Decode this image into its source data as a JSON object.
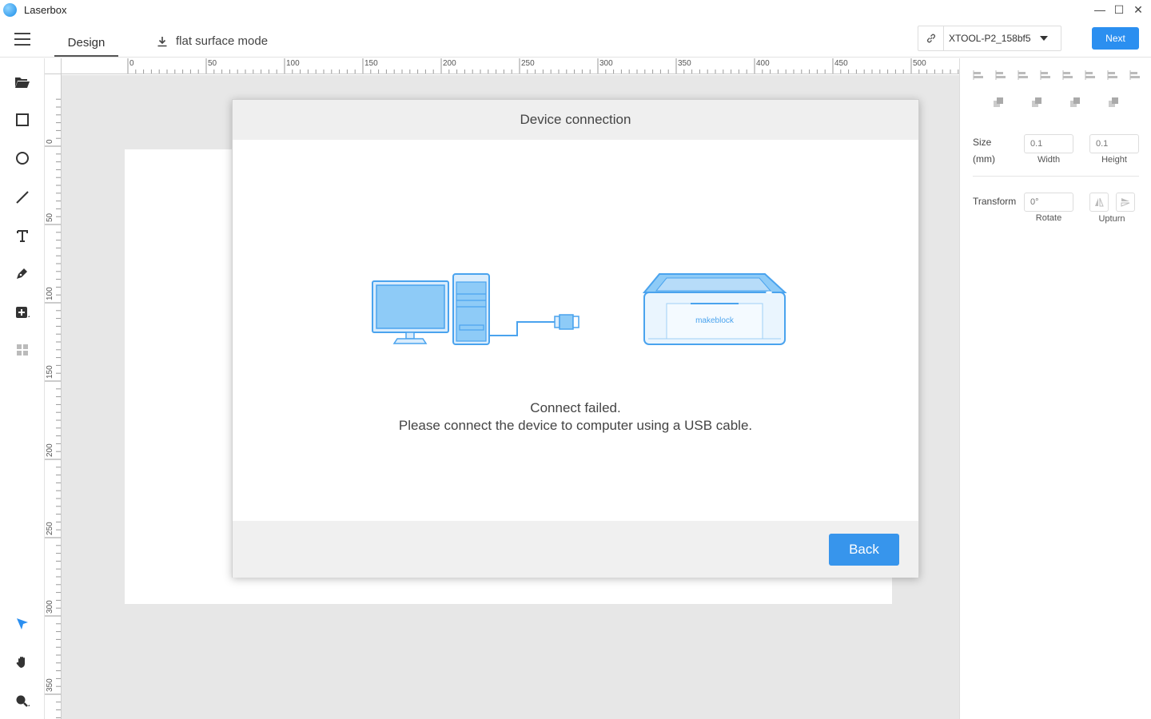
{
  "app": {
    "title": "Laserbox"
  },
  "window": {
    "minimize": "—",
    "maximize": "☐",
    "close": "✕"
  },
  "header": {
    "tab_design": "Design",
    "flat_mode": "flat surface mode",
    "device_name": "XTOOL-P2_158bf5",
    "next_label": "Next"
  },
  "ruler": {
    "top_labels": [
      "0",
      "50",
      "100",
      "150",
      "200",
      "250",
      "300",
      "350",
      "400",
      "450",
      "500"
    ],
    "left_labels": [
      "0",
      "50",
      "100",
      "150",
      "200",
      "250",
      "300",
      "350"
    ]
  },
  "right_panel": {
    "size_label": "Size",
    "size_unit": "(mm)",
    "width_placeholder": "0.1",
    "height_placeholder": "0.1",
    "width_caption": "Width",
    "height_caption": "Height",
    "transform_label": "Transform",
    "rotate_placeholder": "0°",
    "rotate_caption": "Rotate",
    "upturn_caption": "Upturn"
  },
  "modal": {
    "title": "Device connection",
    "message_line1": "Connect failed.",
    "message_line2": "Please connect the device to computer using a USB cable.",
    "brand": "makeblock",
    "back_label": "Back"
  },
  "colors": {
    "accent": "#2b8ff0",
    "illustration": "#4aa3ee",
    "canvas_bg": "#e7e7e7"
  }
}
